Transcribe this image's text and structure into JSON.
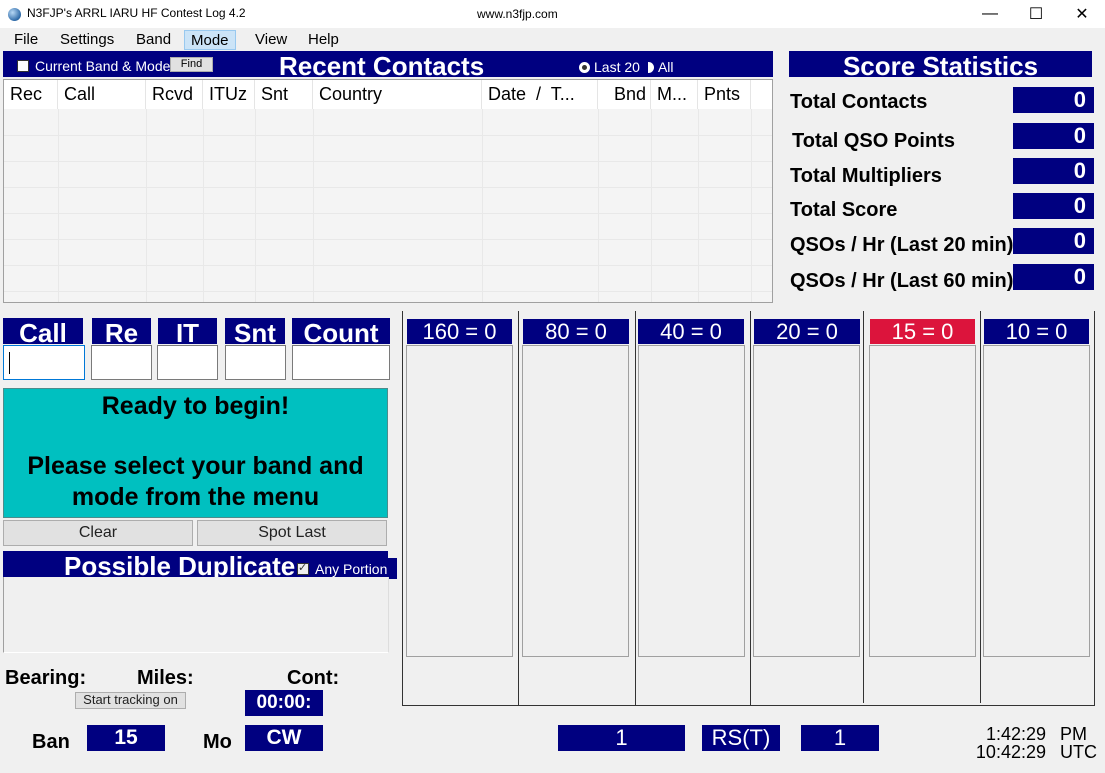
{
  "window": {
    "title": "N3FJP's ARRL IARU HF Contest Log 4.2",
    "url": "www.n3fjp.com",
    "minimize": "—",
    "maximize": "☐",
    "close": "✕"
  },
  "menu": [
    {
      "label": "File"
    },
    {
      "label": "Settings"
    },
    {
      "label": "Band"
    },
    {
      "label": "Mode",
      "active": true
    },
    {
      "label": "View"
    },
    {
      "label": "Help"
    }
  ],
  "recent_contacts": {
    "title": "Recent Contacts",
    "current_band_mode_label": "Current Band & Mode",
    "current_band_mode_checked": false,
    "find_label": "Find",
    "radio_last20": "Last 20",
    "radio_all": "All",
    "selected": "Last 20",
    "columns": [
      "Rec",
      "Call",
      "Rcvd",
      "ITUz",
      "Snt",
      "Country",
      "Date  /  T...",
      "Bnd",
      "M...",
      "Pnts"
    ],
    "rows": []
  },
  "score_statistics": {
    "title": "Score Statistics",
    "items": [
      {
        "label": "Total Contacts",
        "value": "0"
      },
      {
        "label": "Total QSO Points",
        "value": "0"
      },
      {
        "label": "Total Multipliers",
        "value": "0"
      },
      {
        "label": "Total Score",
        "value": "0"
      },
      {
        "label": "QSOs / Hr (Last 20 min)",
        "value": "0"
      },
      {
        "label": "QSOs / Hr (Last 60 min)",
        "value": "0"
      }
    ]
  },
  "entry": {
    "fields": [
      {
        "label": "Call",
        "value": ""
      },
      {
        "label": "Re",
        "value": ""
      },
      {
        "label": "IT",
        "value": ""
      },
      {
        "label": "Snt",
        "value": ""
      },
      {
        "label": "Count",
        "value": ""
      }
    ]
  },
  "status": {
    "line1": "Ready to begin!",
    "line2": "Please select your band and mode from the menu",
    "bg_color": "#00c0c0"
  },
  "buttons": {
    "clear": "Clear",
    "spot_last": "Spot Last",
    "start_tracking": "Start tracking on"
  },
  "possible_duplicates": {
    "title": "Possible Duplicates",
    "any_portion_label": "Any Portion",
    "any_portion_checked": true,
    "items": []
  },
  "location": {
    "bearing_label": "Bearing:",
    "miles_label": "Miles:",
    "cont_label": "Cont:",
    "timer": "00:00:"
  },
  "band_mode": {
    "band_label": "Ban",
    "band_value": "15",
    "mode_label": "Mo",
    "mode_value": "CW"
  },
  "bands": [
    {
      "label": "160 = 0",
      "active": false
    },
    {
      "label": "80 = 0",
      "active": false
    },
    {
      "label": "40 = 0",
      "active": false
    },
    {
      "label": "20 = 0",
      "active": false
    },
    {
      "label": "15 = 0",
      "active": true
    },
    {
      "label": "10 = 0",
      "active": false
    }
  ],
  "colors": {
    "navy": "#000080",
    "active_band": "#dc143c",
    "status_bg": "#00c0c0"
  },
  "bottom": {
    "counter_value": "1",
    "rst_label": "RS(T)",
    "rst_value": "1",
    "local_time": "1:42:29",
    "local_suffix": "PM",
    "utc_time": "10:42:29",
    "utc_suffix": "UTC"
  }
}
